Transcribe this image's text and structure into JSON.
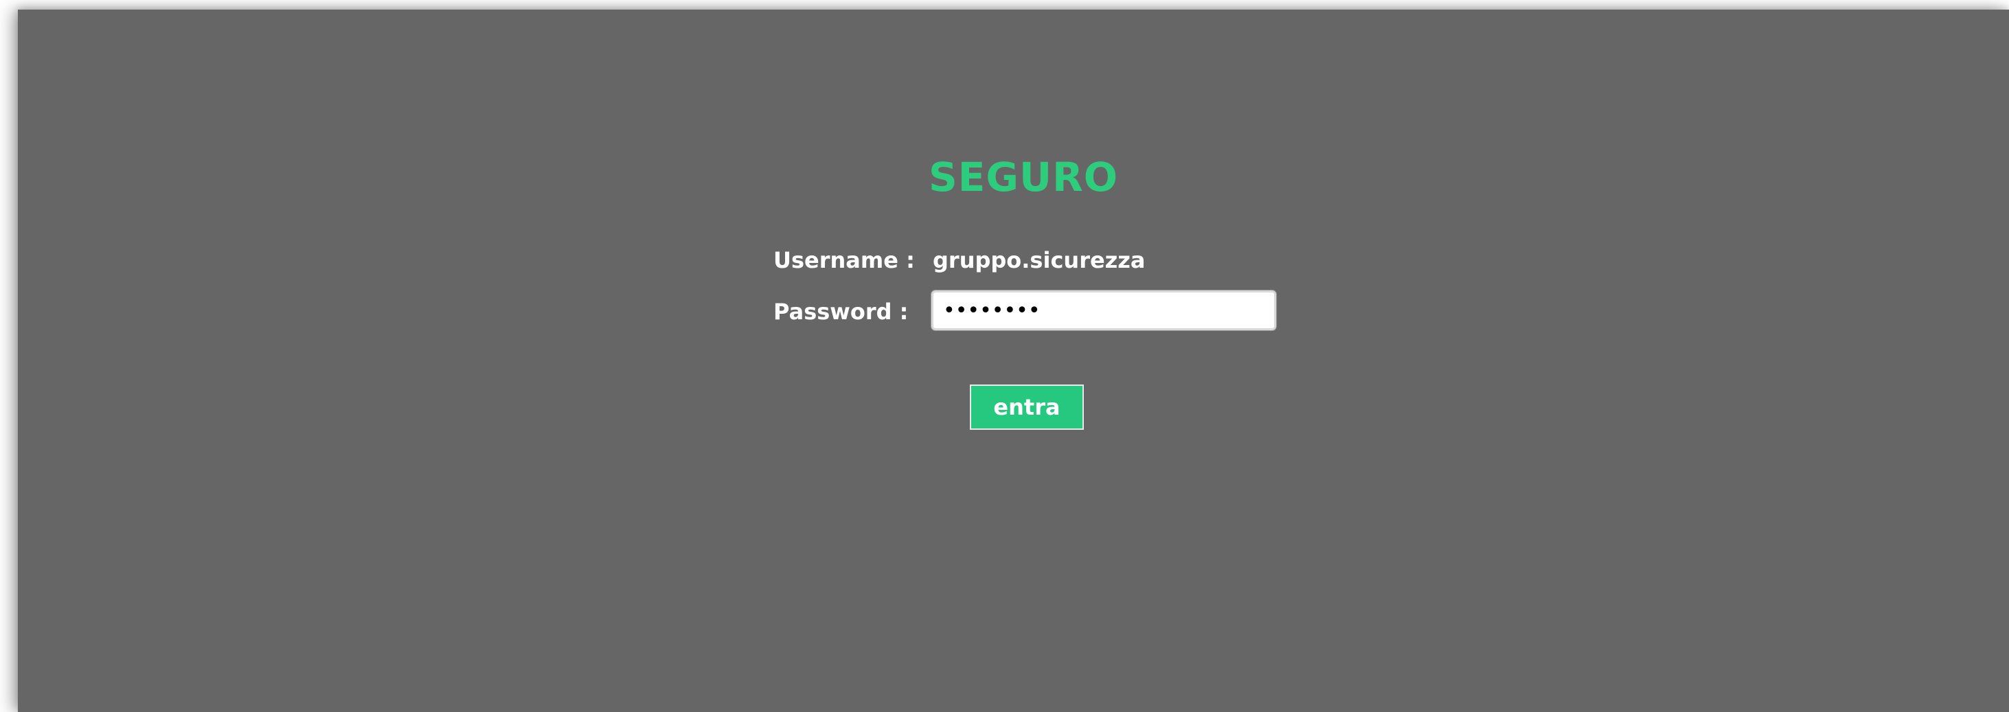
{
  "login": {
    "title": "SEGURO",
    "username_label": "Username :",
    "username_value": "gruppo.sicurezza",
    "password_label": "Password :",
    "password_value": "••••••••",
    "submit_label": "entra"
  },
  "colors": {
    "background": "#666666",
    "accent": "#2ecc7d",
    "button": "#26c77f",
    "text": "#ffffff"
  }
}
